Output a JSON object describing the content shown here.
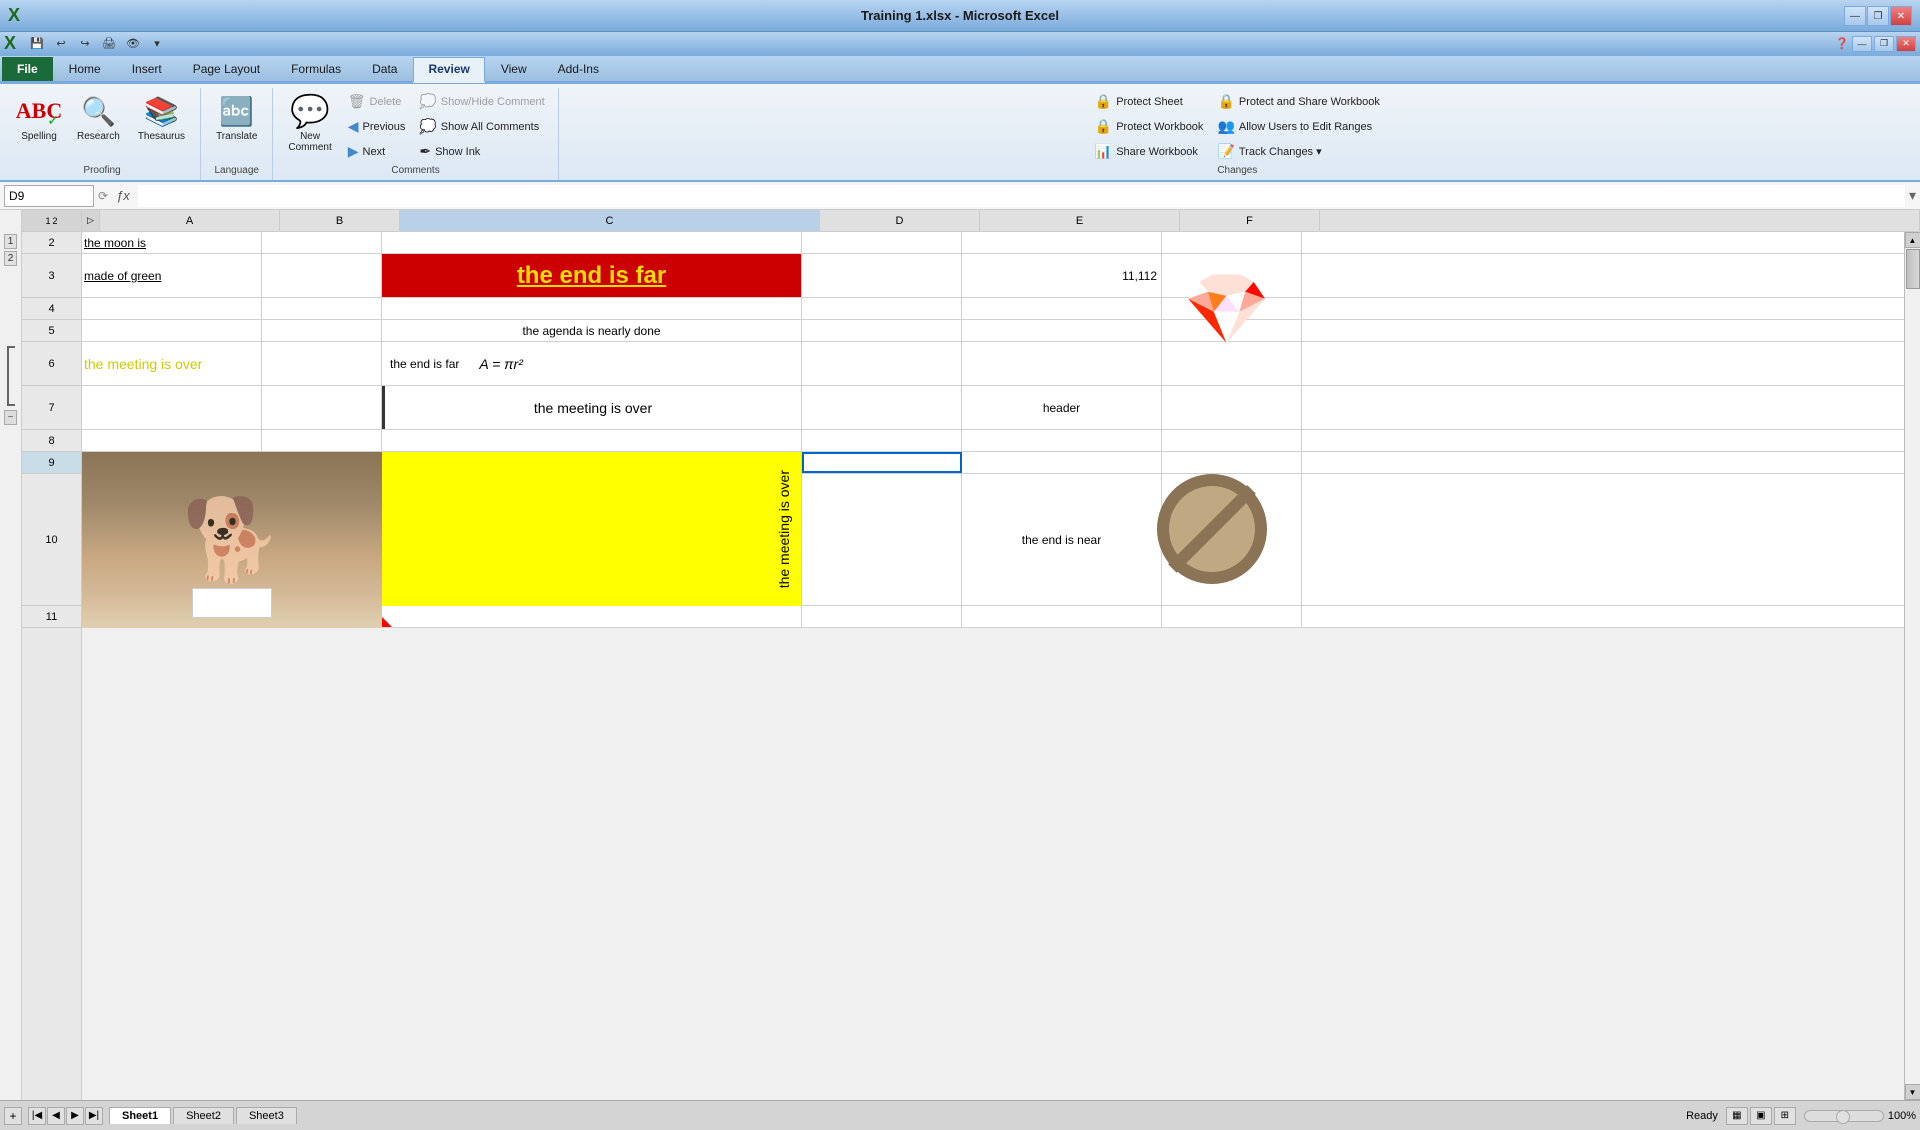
{
  "window": {
    "title": "Training 1.xlsx - Microsoft Excel",
    "minimize": "🗕",
    "maximize": "🗖",
    "close": "✕"
  },
  "qat": {
    "buttons": [
      "💾",
      "↩",
      "↪",
      "🖨",
      "👁"
    ]
  },
  "tabs": {
    "items": [
      "File",
      "Home",
      "Insert",
      "Page Layout",
      "Formulas",
      "Data",
      "Review",
      "View",
      "Add-Ins"
    ],
    "active": "Review"
  },
  "ribbon": {
    "groups": [
      {
        "name": "Proofing",
        "label": "Proofing",
        "items": [
          {
            "id": "spelling",
            "icon": "ABC✓",
            "label": "Spelling",
            "type": "large"
          },
          {
            "id": "research",
            "icon": "📖",
            "label": "Research",
            "type": "large"
          },
          {
            "id": "thesaurus",
            "icon": "📚",
            "label": "Thesaurus",
            "type": "large"
          }
        ]
      },
      {
        "name": "Language",
        "label": "Language",
        "items": [
          {
            "id": "translate",
            "icon": "🔤",
            "label": "Translate",
            "type": "large"
          }
        ]
      },
      {
        "name": "Comments",
        "label": "Comments",
        "items": [
          {
            "id": "new-comment",
            "icon": "💬",
            "label": "New\nComment",
            "type": "large"
          },
          {
            "id": "delete",
            "icon": "🗑",
            "label": "Delete",
            "type": "small",
            "disabled": true
          },
          {
            "id": "previous",
            "icon": "◀",
            "label": "Previous",
            "type": "small"
          },
          {
            "id": "next",
            "icon": "▶",
            "label": "Next",
            "type": "small"
          },
          {
            "id": "show-hide",
            "icon": "💭",
            "label": "Show/Hide Comment",
            "type": "small",
            "disabled": true
          },
          {
            "id": "show-all",
            "icon": "💭",
            "label": "Show All Comments",
            "type": "small"
          },
          {
            "id": "show-ink",
            "icon": "✒",
            "label": "Show Ink",
            "type": "small"
          }
        ]
      },
      {
        "name": "Changes",
        "label": "Changes",
        "items": [
          {
            "id": "protect-sheet",
            "icon": "🔒",
            "label": "Protect Sheet",
            "type": "small"
          },
          {
            "id": "protect-workbook",
            "icon": "🔒",
            "label": "Protect Workbook",
            "type": "small"
          },
          {
            "id": "share-workbook",
            "icon": "📊",
            "label": "Share Workbook",
            "type": "small"
          },
          {
            "id": "protect-share",
            "icon": "🔒",
            "label": "Protect and Share Workbook",
            "type": "small"
          },
          {
            "id": "allow-users",
            "icon": "👥",
            "label": "Allow Users to Edit Ranges",
            "type": "small"
          },
          {
            "id": "track-changes",
            "icon": "📝",
            "label": "Track Changes ▾",
            "type": "small"
          }
        ]
      }
    ]
  },
  "formula_bar": {
    "cell_ref": "D9",
    "formula": ""
  },
  "columns": {
    "numbers": [
      "1",
      "2"
    ],
    "letters": [
      "A",
      "B",
      "C",
      "D",
      "E",
      "F"
    ],
    "widths": [
      180,
      120,
      420,
      160,
      200,
      140
    ]
  },
  "rows": {
    "numbers": [
      "2",
      "3",
      "4",
      "5",
      "6",
      "7",
      "8",
      "9",
      "10",
      "11"
    ]
  },
  "cells": {
    "A2": {
      "text": "the moon is",
      "underline": true,
      "align": "left"
    },
    "A3": {
      "text": "made of green",
      "underline": true,
      "align": "left"
    },
    "C3": {
      "text": "the end is far",
      "bg": "#cc0000",
      "color": "#ffdd00",
      "fontSize": 22,
      "bold": true,
      "underline": true,
      "align": "center"
    },
    "E3": {
      "text": "11,112",
      "align": "right"
    },
    "C5": {
      "text": "the agenda is nearly done",
      "align": "center"
    },
    "A6": {
      "text": "the meeting is over",
      "color": "#cccc00",
      "fontSize": 14
    },
    "C6": {
      "text": "the end is far",
      "align": "left"
    },
    "C6b": {
      "text": "A = πr²",
      "math": true
    },
    "C7": {
      "text": "the meeting is over",
      "align": "center",
      "leftBorder": true
    },
    "E7": {
      "text": "header",
      "align": "center"
    },
    "C9_10": {
      "text": "the\nmeeting\nis\nover",
      "bg": "#ffff00",
      "rotated": true
    },
    "E10": {
      "text": "the end is near",
      "align": "center"
    }
  },
  "images": {
    "dog": {
      "row": "9-10",
      "col": "A",
      "emoji": "🐕",
      "description": "golden retriever dog with white box"
    },
    "gem": {
      "row": "2-4",
      "col": "F",
      "emoji": "💎",
      "description": "cyan gem/jewel with stars"
    },
    "nosign": {
      "row": "9-10",
      "col": "F",
      "emoji": "🚫",
      "description": "no sign brown/tan"
    }
  },
  "sheet_tabs": [
    "Sheet1",
    "Sheet2",
    "Sheet3"
  ],
  "active_sheet": "Sheet1"
}
